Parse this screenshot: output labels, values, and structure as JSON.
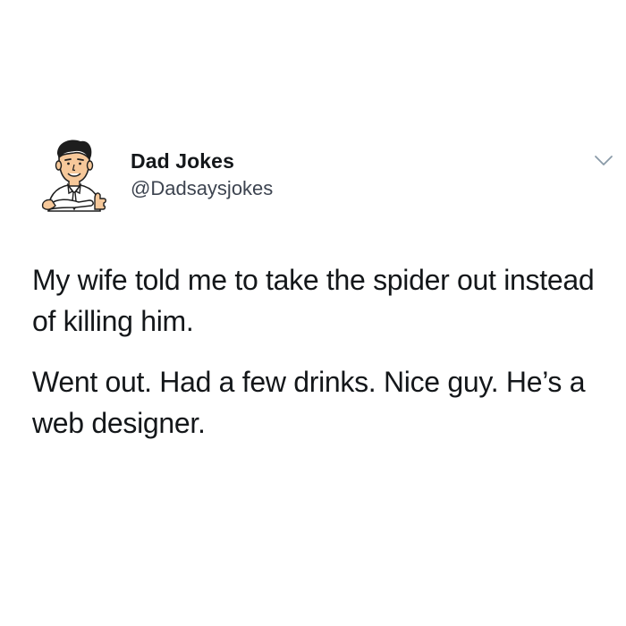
{
  "tweet": {
    "author": {
      "display_name": "Dad Jokes",
      "handle": "@Dadsaysjokes",
      "avatar_icon": "cartoon-dad-avatar-icon"
    },
    "menu_icon": "chevron-down-icon",
    "paragraphs": [
      "My wife told me to take the spider out instead of killing him.",
      "Went out. Had a few drinks. Nice guy. He’s a web designer."
    ]
  }
}
